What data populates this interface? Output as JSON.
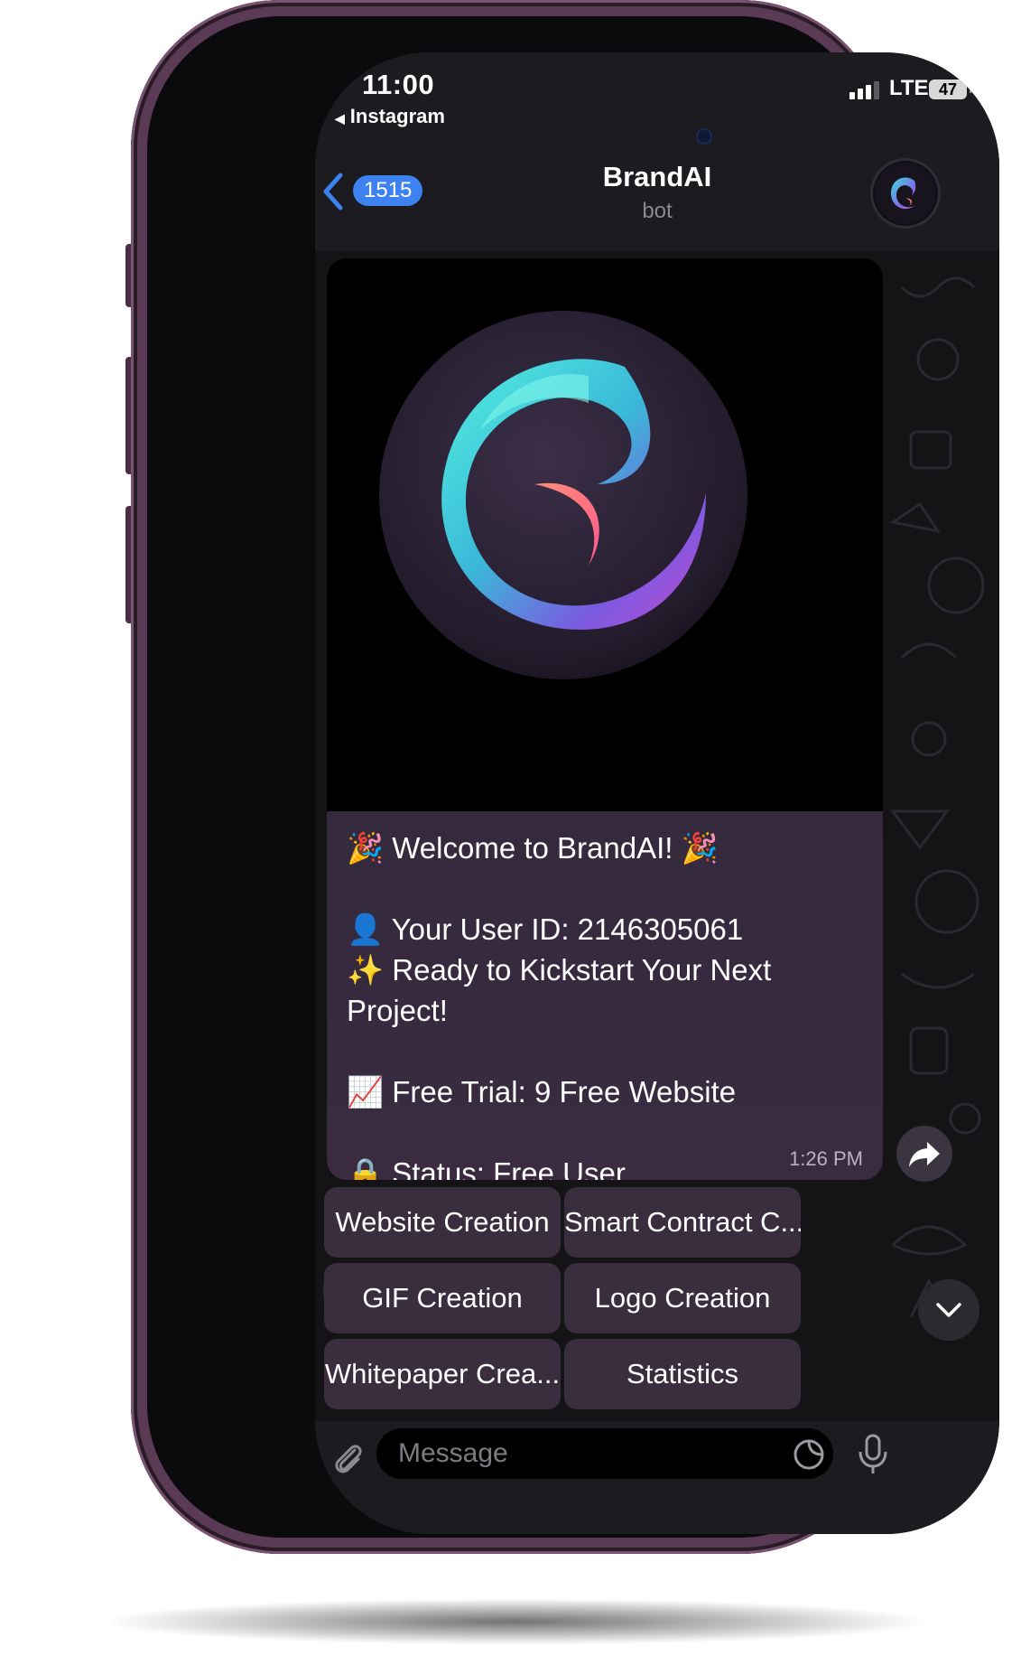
{
  "status_bar": {
    "time": "11:00",
    "back_app": "Instagram",
    "network": "LTE",
    "battery": "47"
  },
  "header": {
    "back_count": "1515",
    "title": "BrandAI",
    "subtitle": "bot",
    "accent": "#3d82f0"
  },
  "message": {
    "lines": {
      "welcome": "🎉 Welcome to BrandAI! 🎉",
      "user_id": "👤 Your User ID: 2146305061",
      "ready": "✨ Ready to Kickstart Your Next Project!",
      "trial": "📈 Free Trial: 9 Free Website",
      "status": "🔒 Status: Free User"
    },
    "time": "1:26 PM"
  },
  "keyboard": [
    "Website Creation",
    "Smart Contract C...",
    "GIF Creation",
    "Logo Creation",
    "Whitepaper Crea...",
    "Statistics"
  ],
  "input": {
    "placeholder": "Message"
  },
  "icons": {
    "back": "chevron-left-icon",
    "share": "forward-arrow-icon",
    "scroll": "chevron-down-icon",
    "attach": "paperclip-icon",
    "sticker": "sticker-icon",
    "mic": "microphone-icon"
  }
}
